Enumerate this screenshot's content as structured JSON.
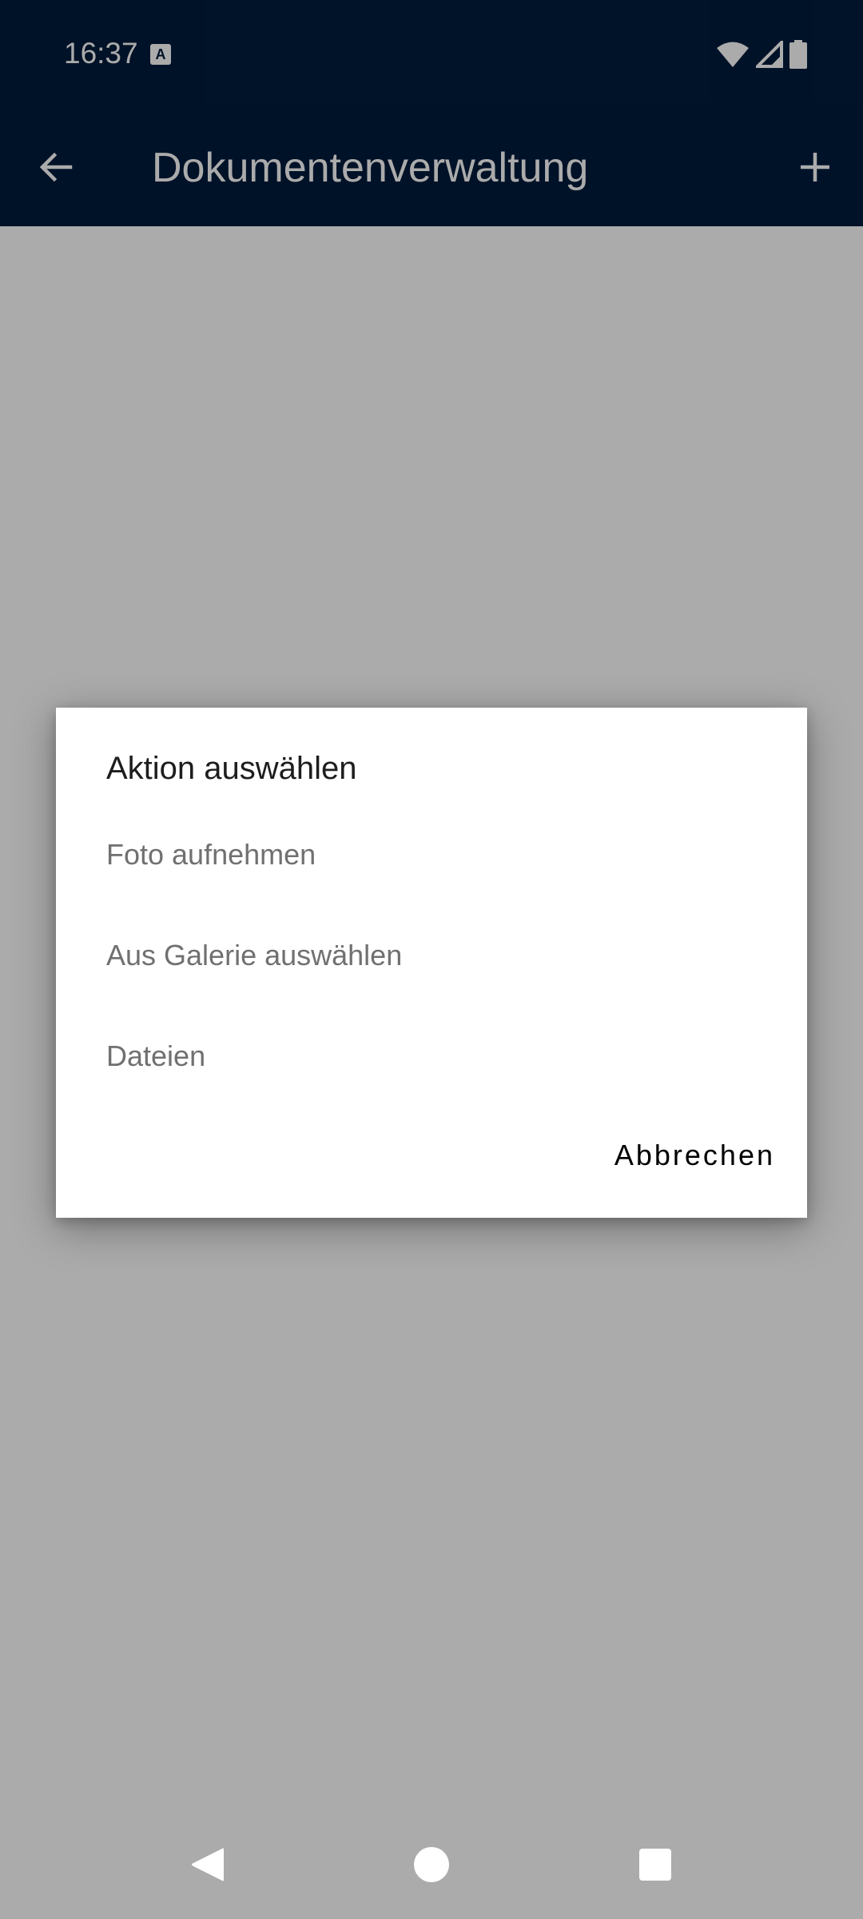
{
  "status_bar": {
    "time": "16:37",
    "notification_glyph": "A",
    "icons": [
      "wifi-icon",
      "signal-icon",
      "battery-icon"
    ]
  },
  "app_bar": {
    "title": "Dokumentenverwaltung",
    "back_icon": "arrow-back-icon",
    "add_icon": "plus-icon",
    "background_color": "#001c3d"
  },
  "dialog": {
    "title": "Aktion auswählen",
    "options": [
      {
        "label": "Foto aufnehmen"
      },
      {
        "label": "Aus Galerie auswählen"
      },
      {
        "label": "Dateien"
      }
    ],
    "cancel_label": "Abbrechen"
  },
  "nav_bar": {
    "icons": [
      "nav-back-icon",
      "nav-home-icon",
      "nav-recents-icon"
    ]
  }
}
